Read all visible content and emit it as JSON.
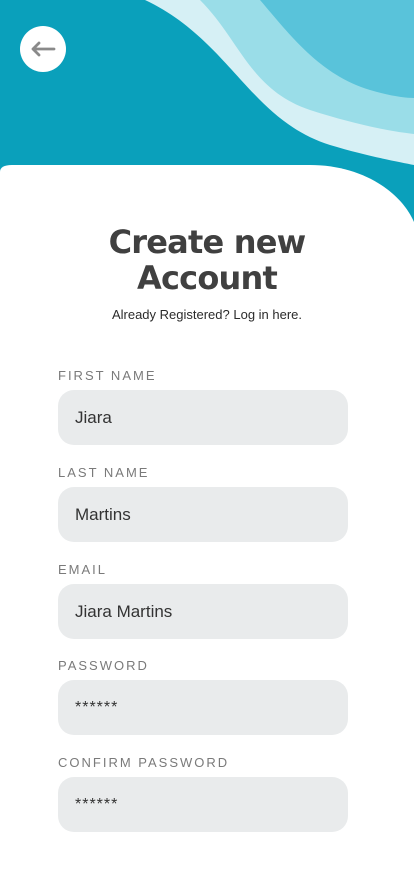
{
  "header": {
    "back_icon": "arrow-left-icon",
    "colors": {
      "base": "#0aa0bb",
      "wave_light": "#d6f0f5",
      "wave_mid": "#9adde8",
      "wave_accent": "#59c3da"
    }
  },
  "title": {
    "line1": "Create new",
    "line2": "Account"
  },
  "subtitle": {
    "text": "Already Registered? ",
    "link": "Log in here."
  },
  "form": {
    "fields": [
      {
        "label": "FIRST NAME",
        "value": "Jiara"
      },
      {
        "label": "LAST NAME",
        "value": "Martins"
      },
      {
        "label": "EMAIL",
        "value": "Jiara Martins"
      },
      {
        "label": "PASSWORD",
        "value": "******"
      },
      {
        "label": "CONFIRM PASSWORD",
        "value": "******"
      }
    ]
  }
}
